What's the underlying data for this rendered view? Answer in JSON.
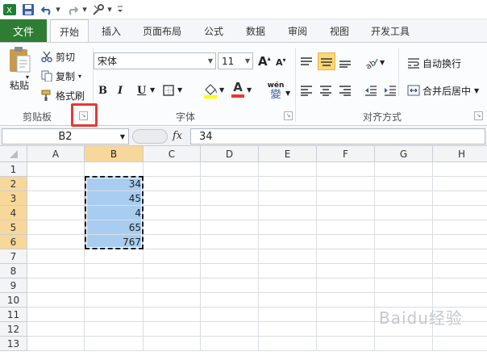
{
  "quick_access": {
    "app_icon": "excel-icon",
    "save_icon": "save-icon",
    "undo_icon": "undo-icon",
    "redo_icon": "redo-icon",
    "customize_icon": "tools-icon",
    "more_glyph": "▾"
  },
  "ribbon_tabs": {
    "file": "文件",
    "home": "开始",
    "insert": "插入",
    "page_layout": "页面布局",
    "formulas": "公式",
    "data": "数据",
    "review": "审阅",
    "view": "视图",
    "developer": "开发工具"
  },
  "clipboard": {
    "paste": "粘贴",
    "cut": "剪切",
    "copy": "复制",
    "format_painter": "格式刷",
    "group_label": "剪贴板"
  },
  "font": {
    "font_name": "宋体",
    "font_size": "11",
    "grow_font": "A",
    "shrink_font": "A",
    "bold": "B",
    "italic": "I",
    "underline": "U",
    "font_color_letter": "A",
    "phonetic": "wén",
    "group_label": "字体"
  },
  "alignment": {
    "wrap_text": "自动换行",
    "merge_center": "合并后居中",
    "group_label": "对齐方式"
  },
  "formula_bar": {
    "name_box": "B2",
    "fx_label": "fx",
    "value": "34"
  },
  "sheet": {
    "columns": [
      "A",
      "B",
      "C",
      "D",
      "E",
      "F",
      "G",
      "H"
    ],
    "rows": [
      "1",
      "2",
      "3",
      "4",
      "5",
      "6",
      "7",
      "8",
      "9",
      "10",
      "11",
      "12",
      "13"
    ],
    "selected_column": "B",
    "selected_rows": [
      "2",
      "3",
      "4",
      "5",
      "6"
    ],
    "b_values": [
      "34",
      "45",
      "4",
      "65",
      "767"
    ]
  },
  "colors": {
    "file_tab": "#2e7d32",
    "selection_fill": "#a8cdf0",
    "header_highlight": "#f8d79a",
    "callout": "#e53935"
  },
  "watermark": "Baidu经验"
}
